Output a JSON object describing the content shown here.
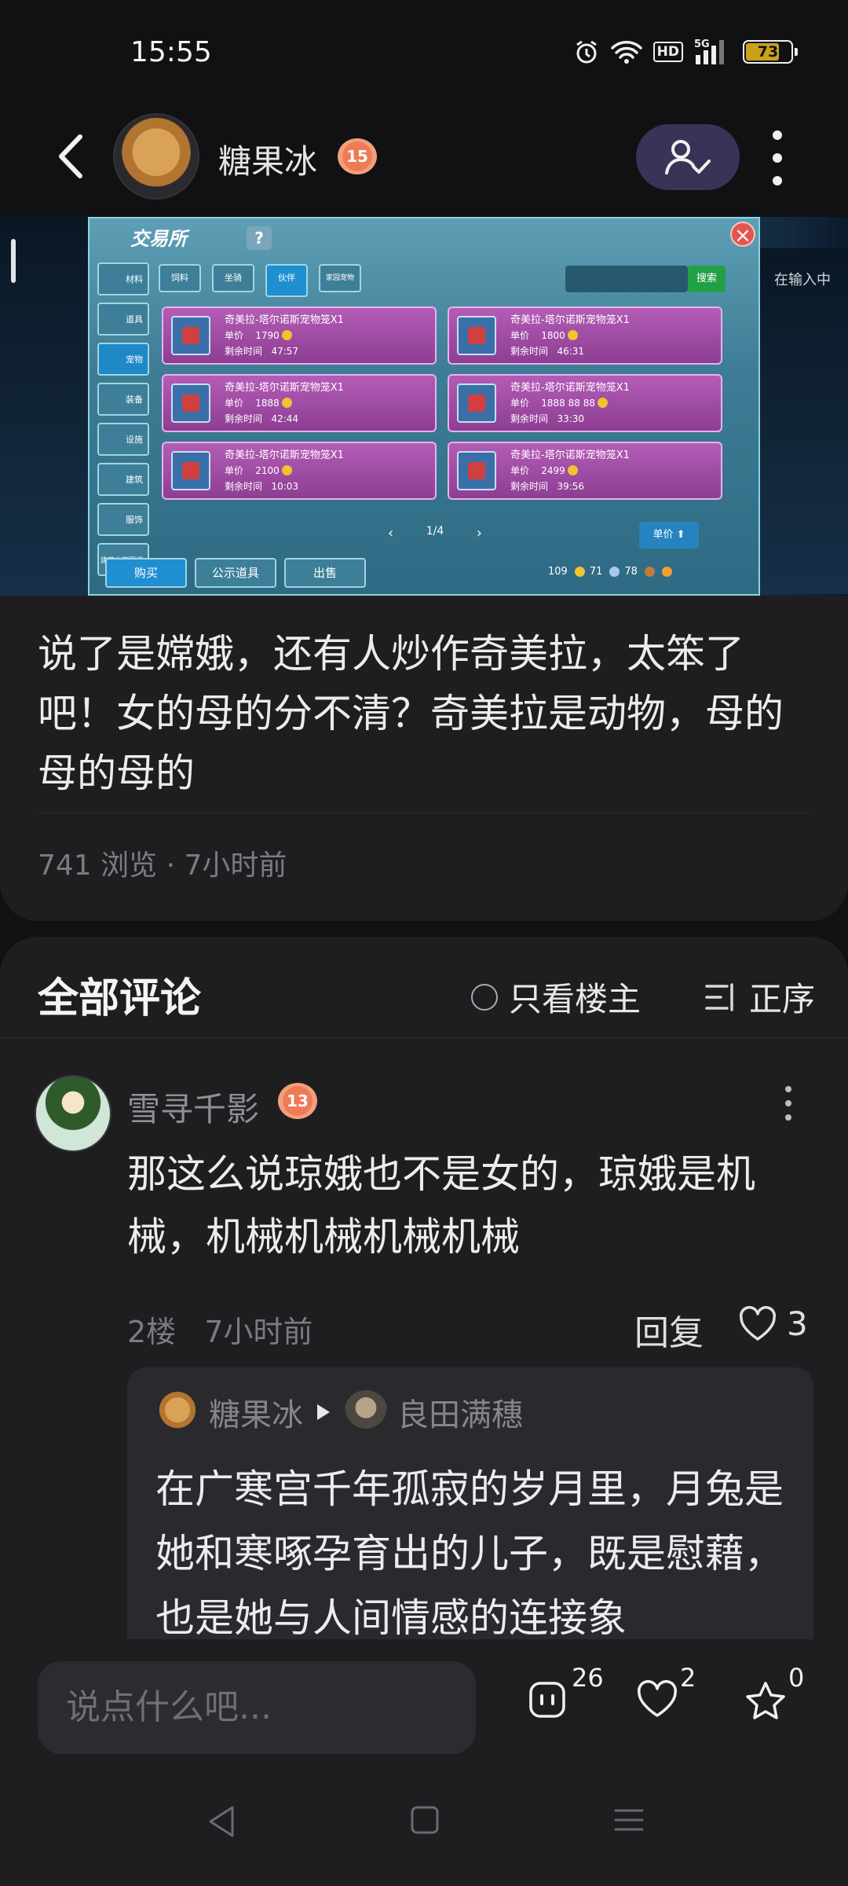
{
  "status_bar": {
    "time": "15:55",
    "network": "HD",
    "signal": "5G",
    "battery": "73",
    "battery_level_pct": 73
  },
  "header": {
    "author_name": "糖果冰",
    "author_level": "15"
  },
  "game_screenshot": {
    "window_title": "交易所",
    "help": "?",
    "side_tabs": [
      "材料",
      "道具",
      "宠物",
      "装备",
      "设施",
      "建筑",
      "服饰",
      "建筑方案图纸"
    ],
    "top_tabs": [
      "饲料",
      "坐骑",
      "伙伴",
      "家园宠物"
    ],
    "search_button": "搜索",
    "listings": [
      {
        "name": "奇美拉-塔尔诺斯宠物笼X1",
        "price_label": "单价",
        "price": "1790",
        "time_label": "剩余时间",
        "time": "47:57"
      },
      {
        "name": "奇美拉-塔尔诺斯宠物笼X1",
        "price_label": "单价",
        "price": "1800",
        "time_label": "剩余时间",
        "time": "46:31"
      },
      {
        "name": "奇美拉-塔尔诺斯宠物笼X1",
        "price_label": "单价",
        "price": "1888",
        "time_label": "剩余时间",
        "time": "42:44"
      },
      {
        "name": "奇美拉-塔尔诺斯宠物笼X1",
        "price_label": "单价",
        "price": "1888 88 88",
        "time_label": "剩余时间",
        "time": "33:30"
      },
      {
        "name": "奇美拉-塔尔诺斯宠物笼X1",
        "price_label": "单价",
        "price": "2100",
        "time_label": "剩余时间",
        "time": "10:03"
      },
      {
        "name": "奇美拉-塔尔诺斯宠物笼X1",
        "price_label": "单价",
        "price": "2499",
        "time_label": "剩余时间",
        "time": "39:56"
      }
    ],
    "page": "1/4",
    "sort_button": "单价",
    "bottom_tabs": [
      "购买",
      "公示道具",
      "出售"
    ],
    "currencies": [
      "109",
      "71",
      "78"
    ],
    "side_hint": "在输入中"
  },
  "post": {
    "text": "说了是嫦娥，还有人炒作奇美拉，太笨了吧！女的母的分不清？奇美拉是动物，母的母的母的",
    "meta": "741 浏览 · 7小时前"
  },
  "comments": {
    "title": "全部评论",
    "only_host": "只看楼主",
    "order": "正序",
    "items": [
      {
        "name": "雪寻千影",
        "level": "13",
        "text": "那这么说琼娥也不是女的，琼娥是机械，机械机械机械机械",
        "floor": "2楼",
        "time": "7小时前",
        "reply_label": "回复",
        "likes": "3",
        "reply": {
          "from": "糖果冰",
          "to": "良田满穗",
          "text": "在广寒宫千年孤寂的岁月里，月兔是她和寒啄孕育出的儿子，既是慰藉，也是她与人间情感的连接象"
        }
      }
    ]
  },
  "bottom_bar": {
    "input_placeholder": "说点什么吧...",
    "comment_count": "26",
    "like_count": "2",
    "fav_count": "0"
  }
}
